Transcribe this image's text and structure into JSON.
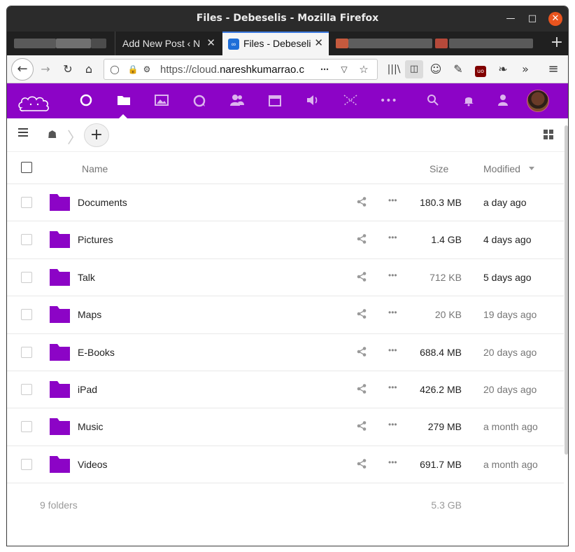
{
  "window": {
    "title": "Files - Debeselis - Mozilla Firefox"
  },
  "tabs": [
    {
      "label": "",
      "blurred": true
    },
    {
      "label": "Add New Post ‹ N",
      "blurred": false
    },
    {
      "label": "Files - Debeseli",
      "blurred": false,
      "active": true
    },
    {
      "label": "",
      "blurred": true
    }
  ],
  "toolbar": {
    "url_prefix": "https://cloud.",
    "url_host": "nareshkumarrao.c",
    "icons": [
      "back-icon",
      "forward-icon",
      "reload-icon",
      "home-icon",
      "shield-icon",
      "lock-icon",
      "permissions-icon",
      "page-actions-icon",
      "pocket-icon",
      "bookmark-star-icon",
      "library-icon",
      "sidebar-icon",
      "account-icon",
      "extension-icon",
      "ublock-icon",
      "extension2-icon",
      "overflow-icon",
      "menu-icon"
    ]
  },
  "nextcloud": {
    "brand_color": "#8c04c6",
    "apps": [
      "dashboard-icon",
      "files-icon",
      "photos-icon",
      "talk-icon",
      "contacts-icon",
      "calendar-icon",
      "audio-icon",
      "maps-icon",
      "more-apps-icon"
    ],
    "right_icons": [
      "search-icon",
      "notifications-icon",
      "contacts-menu-icon",
      "avatar"
    ]
  },
  "files": {
    "header": {
      "name": "Name",
      "size": "Size",
      "modified": "Modified"
    },
    "rows": [
      {
        "name": "Documents",
        "size": "180.3 MB",
        "modified": "a day ago",
        "size_dim": false,
        "mod_dim": false
      },
      {
        "name": "Pictures",
        "size": "1.4 GB",
        "modified": "4 days ago",
        "size_dim": false,
        "mod_dim": false
      },
      {
        "name": "Talk",
        "size": "712 KB",
        "modified": "5 days ago",
        "size_dim": true,
        "mod_dim": false
      },
      {
        "name": "Maps",
        "size": "20 KB",
        "modified": "19 days ago",
        "size_dim": true,
        "mod_dim": true
      },
      {
        "name": "E-Books",
        "size": "688.4 MB",
        "modified": "20 days ago",
        "size_dim": false,
        "mod_dim": true
      },
      {
        "name": "iPad",
        "size": "426.2 MB",
        "modified": "20 days ago",
        "size_dim": false,
        "mod_dim": true
      },
      {
        "name": "Music",
        "size": "279 MB",
        "modified": "a month ago",
        "size_dim": false,
        "mod_dim": true
      },
      {
        "name": "Videos",
        "size": "691.7 MB",
        "modified": "a month ago",
        "size_dim": false,
        "mod_dim": true
      }
    ],
    "footer": {
      "count": "9 folders",
      "total": "5.3 GB"
    },
    "colors": {
      "folder": "#8c04c6",
      "dim_text": "#767676"
    }
  }
}
